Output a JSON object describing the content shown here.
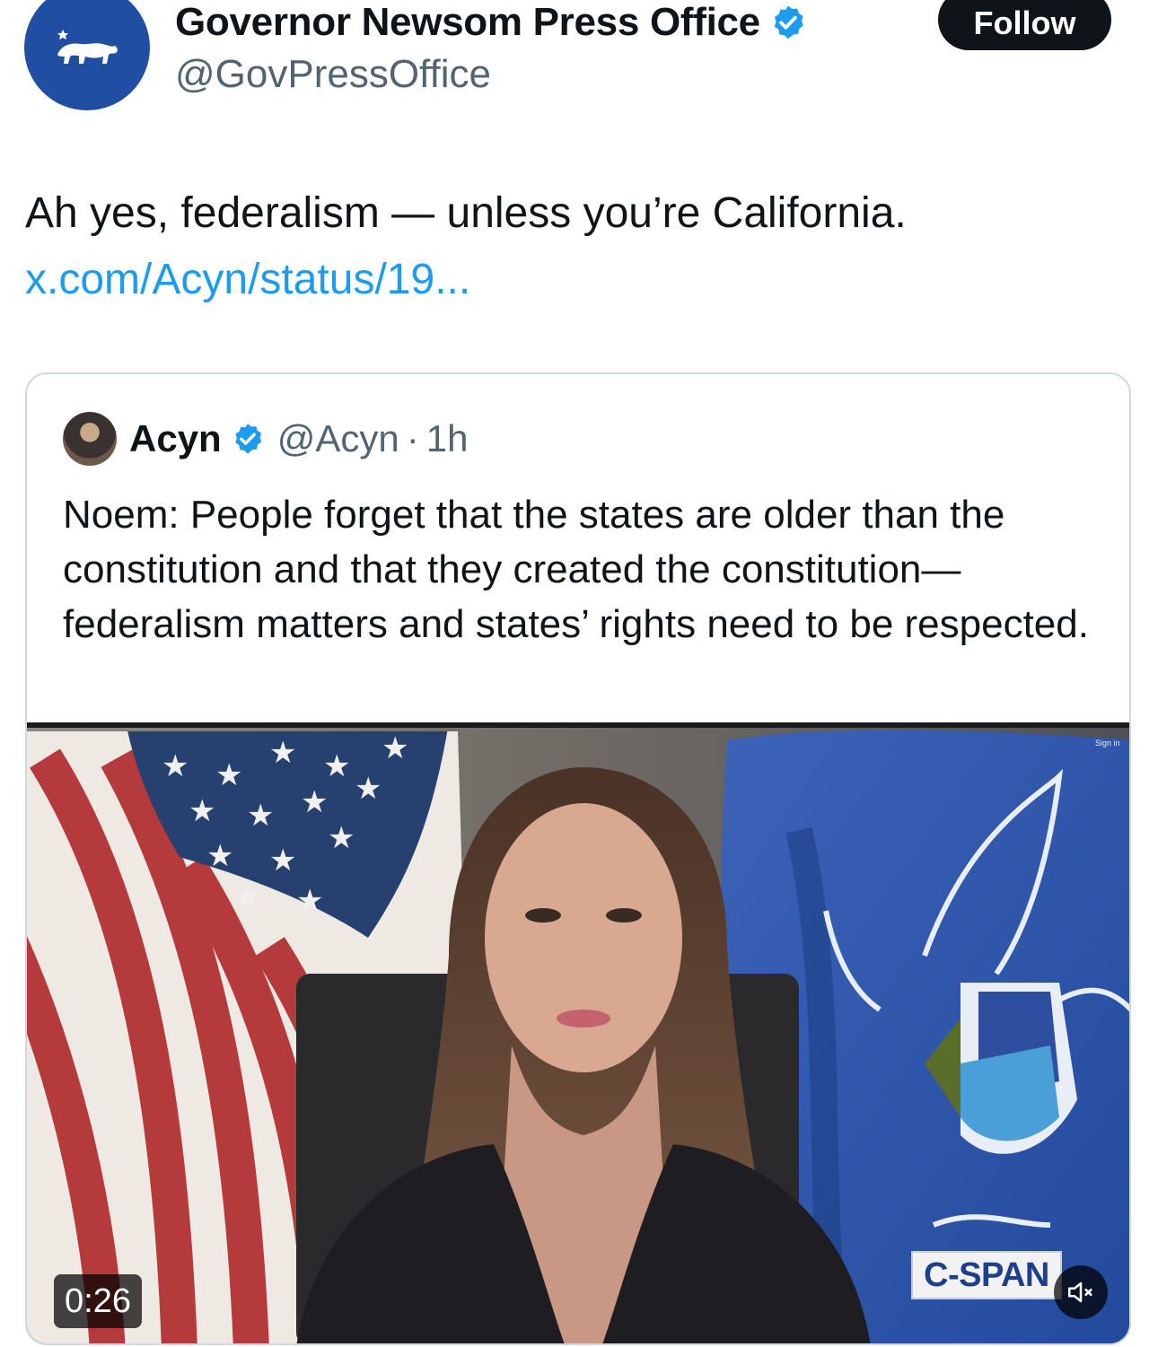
{
  "post": {
    "author": {
      "display_name": "Governor Newsom Press Office",
      "handle": "@GovPressOffice",
      "verified": true
    },
    "follow_label": "Follow",
    "text": "Ah yes, federalism — unless you’re California.",
    "link_text": "x.com/Acyn/status/19..."
  },
  "quoted": {
    "author": {
      "display_name": "Acyn",
      "handle": "@Acyn",
      "separator": "·",
      "time": "1h",
      "verified": true
    },
    "text": "Noem: People forget that the states are older than the constitution and that they created the constitution—federalism matters and states’ rights need to be respected.",
    "video": {
      "duration": "0:26",
      "watermark": "C-SPAN",
      "corner_tag": "Sign in",
      "muted": true
    }
  },
  "colors": {
    "accent": "#1d9bf0",
    "avatar_bg": "#1f4ea3",
    "verified": "#1d9bf0",
    "follow_bg": "#0f1419"
  },
  "icons": {
    "avatar": "california-bear-icon",
    "verified": "verified-badge-icon",
    "mute": "speaker-muted-icon"
  }
}
